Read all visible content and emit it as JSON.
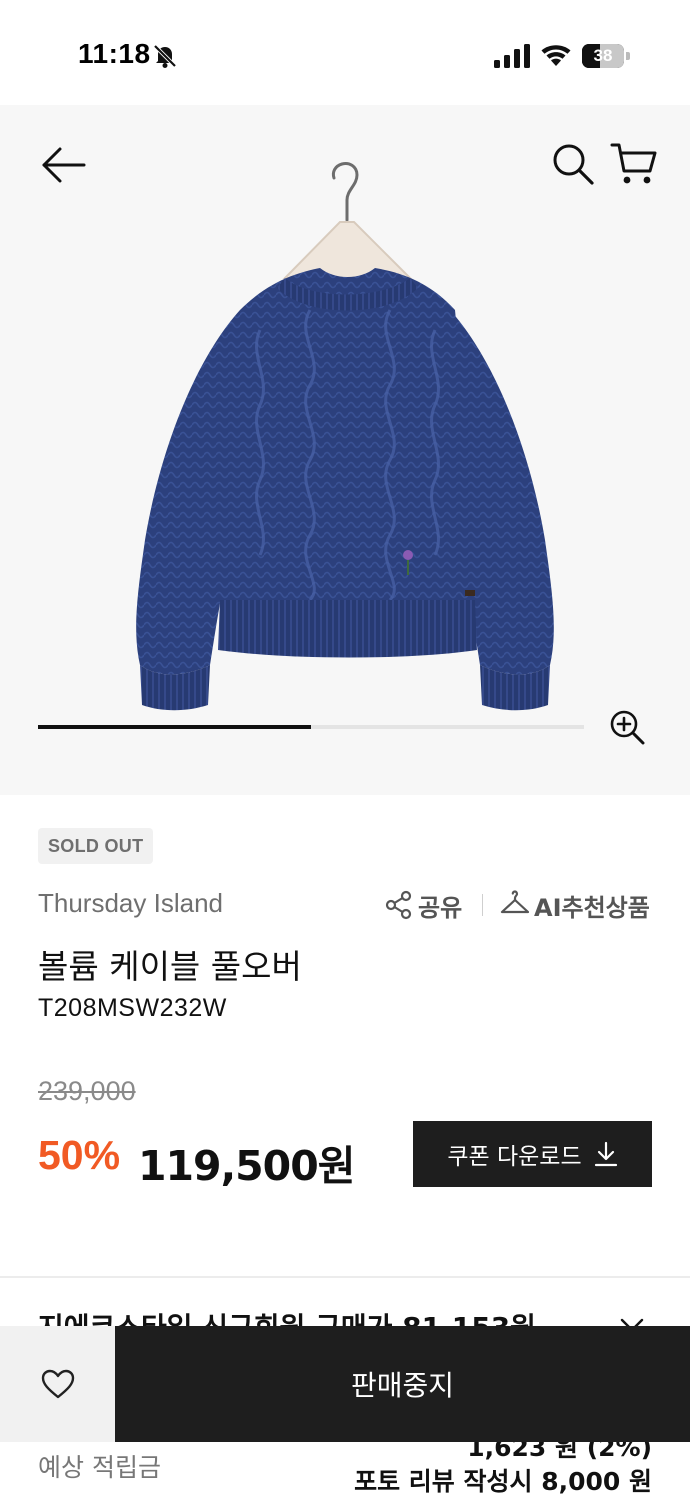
{
  "status_bar": {
    "time": "11:18",
    "battery": "38",
    "icons": [
      "bell-off-icon",
      "signal-icon",
      "wifi-icon",
      "battery-icon"
    ]
  },
  "hero": {
    "icons": [
      "back-arrow-icon",
      "search-icon",
      "cart-icon",
      "zoom-in-icon"
    ],
    "image_progress": 0.5,
    "image": "navy cable-knit sweater on hanger"
  },
  "product": {
    "status_badge": "SOLD OUT",
    "brand": "Thursday Island",
    "share_label": "공유",
    "ai_label": "AI추천상품",
    "name": "볼륨 케이블 풀오버",
    "code": "T208MSW232W",
    "original_price": "239,000",
    "discount_rate": "50%",
    "price": "119,500원",
    "coupon_label": "쿠폰 다운로드"
  },
  "benefits": {
    "partial_row": "지에코스타일 신규회원 구매가 81,153원",
    "points_label": "예상 적립금",
    "points_value": "1,623 원 (2%)",
    "review_bonus": "포토 리뷰 작성시 8,000 원"
  },
  "bottom_bar": {
    "stop_label": "판매중지"
  },
  "colors": {
    "accent_discount": "#f15a24",
    "button_dark": "#1e1e1e",
    "sweater_navy": "#2b3f7a"
  }
}
